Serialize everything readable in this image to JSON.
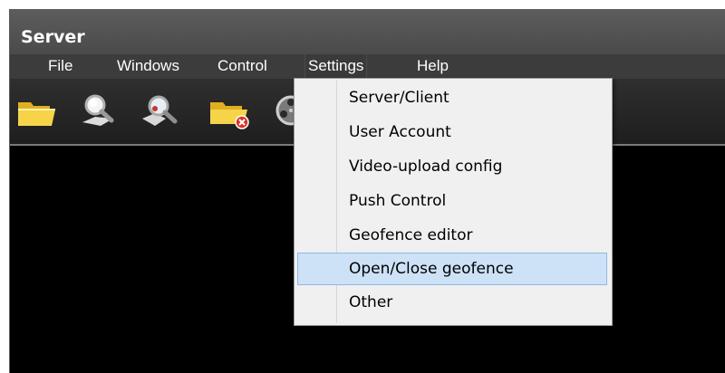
{
  "window": {
    "title": "Server"
  },
  "menubar": {
    "items": [
      {
        "label": "File"
      },
      {
        "label": "Windows"
      },
      {
        "label": "Control"
      },
      {
        "label": "Settings"
      },
      {
        "label": "Help"
      }
    ]
  },
  "toolbar": {
    "icons": [
      "open-folder-icon",
      "search-icon",
      "search-map-icon",
      "folder-delete-icon",
      "film-reel-icon"
    ]
  },
  "settings_menu": {
    "items": [
      {
        "label": "Server/Client"
      },
      {
        "label": "User Account"
      },
      {
        "label": "Video-upload config"
      },
      {
        "label": "Push Control"
      },
      {
        "label": "Geofence editor"
      },
      {
        "label": "Open/Close geofence",
        "highlighted": true
      },
      {
        "label": "Other"
      }
    ]
  },
  "colors": {
    "titlebar": "#555555",
    "menubar": "#3c3c3c",
    "content_background": "#000000",
    "menu_background": "#f0f0f0",
    "highlight": "#cde2f7",
    "highlight_border": "#8fb8e6",
    "folder": "#f4d03f"
  }
}
